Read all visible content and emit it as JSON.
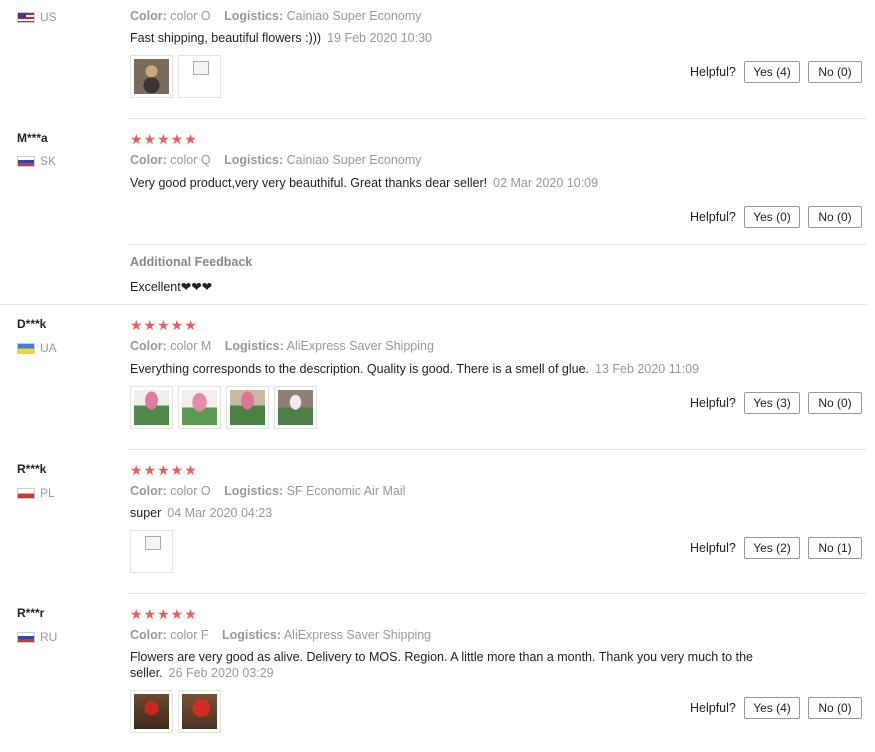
{
  "helpful_label": "Helpful?",
  "labels": {
    "color": "Color:",
    "logistics": "Logistics:"
  },
  "colors": {
    "star": "#f05a5a",
    "muted": "#999999",
    "border": "#e6e6e6"
  },
  "reviews": [
    {
      "user": "",
      "country": "US",
      "flag_icon": "flag-us-icon",
      "color_value": "color O",
      "logistics_value": "Cainiao Super Economy",
      "text": "Fast shipping, beautiful flowers :)))",
      "date": "19 Feb 2020 10:30",
      "yes": "Yes (4)",
      "no": "No (0)"
    },
    {
      "user": "M***a",
      "country": "SK",
      "flag_icon": "flag-sk-icon",
      "stars": "★★★★★",
      "color_value": "color Q",
      "logistics_value": "Cainiao Super Economy",
      "text": "Very good product,very very beauthiful. Great thanks dear seller!",
      "date": "02 Mar 2020 10:09",
      "yes": "Yes (0)",
      "no": "No (0)",
      "additional_title": "Additional Feedback",
      "additional_text": "Excellent❤❤❤"
    },
    {
      "user": "D***k",
      "country": "UA",
      "flag_icon": "flag-ua-icon",
      "stars": "★★★★★",
      "color_value": "color M",
      "logistics_value": "AliExpress Saver Shipping",
      "text": "Everything corresponds to the description. Quality is good. There is a smell of glue.",
      "date": "13 Feb 2020 11:09",
      "yes": "Yes (3)",
      "no": "No (0)"
    },
    {
      "user": "R***k",
      "country": "PL",
      "flag_icon": "flag-pl-icon",
      "stars": "★★★★★",
      "color_value": "color O",
      "logistics_value": "SF Economic Air Mail",
      "text": "super",
      "date": "04 Mar 2020 04:23",
      "yes": "Yes (2)",
      "no": "No (1)"
    },
    {
      "user": "R***r",
      "country": "RU",
      "flag_icon": "flag-ru-icon",
      "stars": "★★★★★",
      "color_value": "color F",
      "logistics_value": "AliExpress Saver Shipping",
      "text": "Flowers are very good as alive. Delivery to MOS. Region. A little more than a month. Thank you very much to the seller.",
      "date": "26 Feb 2020 03:29",
      "yes": "Yes (4)",
      "no": "No (0)"
    }
  ]
}
